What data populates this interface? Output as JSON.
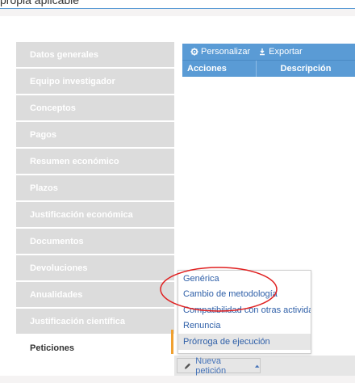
{
  "page": {
    "title_fragment": "propia aplicable"
  },
  "sidebar": {
    "items": [
      {
        "label": "Datos generales"
      },
      {
        "label": "Equipo investigador"
      },
      {
        "label": "Conceptos"
      },
      {
        "label": "Pagos"
      },
      {
        "label": "Resumen económico"
      },
      {
        "label": "Plazos"
      },
      {
        "label": "Justificación económica"
      },
      {
        "label": "Documentos"
      },
      {
        "label": "Devoluciones"
      },
      {
        "label": "Anualidades"
      },
      {
        "label": "Justificación científica"
      },
      {
        "label": "Peticiones"
      }
    ],
    "active": "Peticiones"
  },
  "grid": {
    "toolbar": {
      "personalizar": "Personalizar",
      "exportar": "Exportar"
    },
    "columns": {
      "acciones": "Acciones",
      "descripcion": "Descripción"
    }
  },
  "dropdown": {
    "items": [
      {
        "label": "Genérica"
      },
      {
        "label": "Cambio de metodología"
      },
      {
        "label": "Compatibilidad con otras actividades"
      },
      {
        "label": "Renuncia"
      },
      {
        "label": "Prórroga de ejecución"
      }
    ],
    "highlighted": "Prórroga de ejecución"
  },
  "footer": {
    "new_request_label": "Nueva petición"
  },
  "colors": {
    "accent_blue": "#5a9bd5",
    "active_marker": "#f0a030",
    "annotation_red": "#e02020",
    "link_blue": "#2e5fa8"
  },
  "icons": {
    "personalizar": "gear-icon",
    "exportar": "export-icon",
    "new_request": "pencil-icon",
    "dropdown": "caret-up-icon"
  }
}
